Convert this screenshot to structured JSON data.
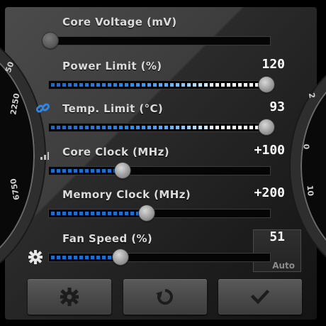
{
  "gauges": {
    "left_labels": [
      "50",
      "2250",
      "6750"
    ],
    "right_labels": [
      "0",
      "10",
      "2"
    ]
  },
  "sliders": [
    {
      "id": "core-voltage",
      "label": "Core Voltage (mV)",
      "value": "",
      "fill": 0.0,
      "enabled": false
    },
    {
      "id": "power-limit",
      "label": "Power Limit (%)",
      "value": "120",
      "fill": 1.0,
      "enabled": true
    },
    {
      "id": "temp-limit",
      "label": "Temp. Limit (°C)",
      "value": "93",
      "fill": 1.0,
      "enabled": true
    },
    {
      "id": "core-clock",
      "label": "Core Clock (MHz)",
      "value": "+100",
      "fill": 0.34,
      "enabled": true
    },
    {
      "id": "memory-clock",
      "label": "Memory Clock (MHz)",
      "value": "+200",
      "fill": 0.45,
      "enabled": true
    },
    {
      "id": "fan-speed",
      "label": "Fan Speed (%)",
      "value": "51",
      "fill": 0.33,
      "enabled": true
    }
  ],
  "fan": {
    "auto_label": "Auto"
  },
  "buttons": {
    "settings": "gear-icon",
    "reset": "reset-icon",
    "apply": "check-icon"
  },
  "colors": {
    "accent": "#3b9bff",
    "link_icon": "#2f86e6"
  }
}
